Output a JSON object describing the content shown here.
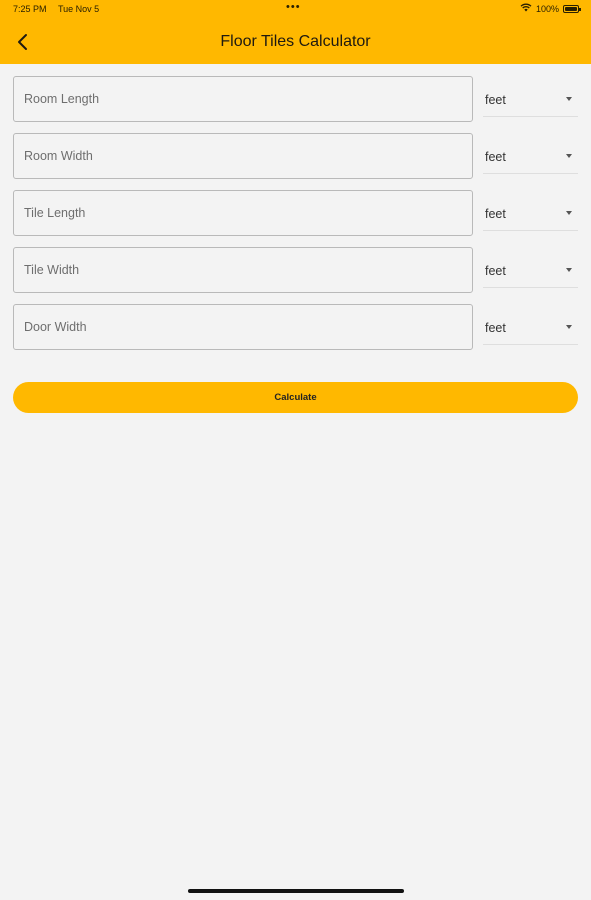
{
  "status_bar": {
    "time": "7:25 PM",
    "date": "Tue Nov 5",
    "dots": "•••",
    "battery_text": "100%",
    "wifi_icon": "wifi-icon",
    "battery_icon": "battery-icon"
  },
  "header": {
    "title": "Floor Tiles Calculator",
    "back_icon": "chevron-left-icon",
    "bar_color": "#ffb800"
  },
  "form": {
    "fields": [
      {
        "placeholder": "Room Length",
        "unit": "feet"
      },
      {
        "placeholder": "Room Width",
        "unit": "feet"
      },
      {
        "placeholder": "Tile Length",
        "unit": "feet"
      },
      {
        "placeholder": "Tile Width",
        "unit": "feet"
      },
      {
        "placeholder": "Door Width",
        "unit": "feet"
      }
    ]
  },
  "calculate_label": "Calculate",
  "colors": {
    "accent": "#ffb800",
    "background": "#f3f3f3"
  }
}
